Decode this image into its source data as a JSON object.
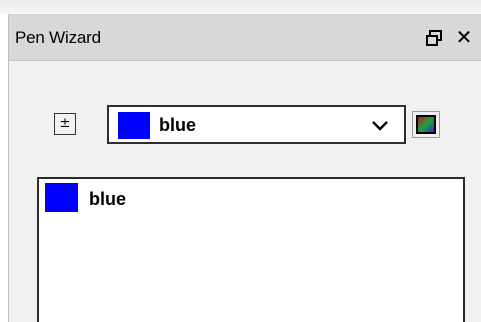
{
  "window": {
    "title": "Pen Wizard",
    "close_glyph": "✕",
    "float_icon": "restore-window-icon"
  },
  "toolbar": {
    "expand_glyph": "±",
    "combo": {
      "selected": "blue",
      "swatch_color": "#0000ff",
      "arrow_icon": "chevron-down-icon"
    },
    "palette_icon": "color-palette-icon"
  },
  "list": {
    "items": [
      {
        "label": "blue",
        "color": "#0000ff"
      }
    ]
  },
  "colors": {
    "titlebar": "#d8d8d8",
    "panel": "#f1f1f1"
  }
}
